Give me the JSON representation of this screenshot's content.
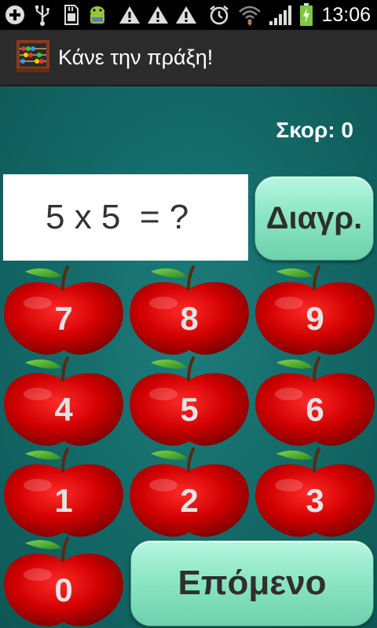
{
  "status_bar": {
    "time": "13:06",
    "icons": [
      "add-icon",
      "usb-icon",
      "sd-card-icon",
      "android-icon",
      "warning-icon",
      "warning-icon",
      "warning-icon",
      "alarm-icon",
      "wifi-icon",
      "signal-icon",
      "battery-charging-icon"
    ]
  },
  "title_bar": {
    "title": "Κάνε την πράξη!",
    "icon": "abacus-icon"
  },
  "game": {
    "score_label": "Σκορ: 0",
    "question": "5 x 5  = ?",
    "clear_label": "Διαγρ.",
    "next_label": "Επόμενο",
    "keypad": [
      "7",
      "8",
      "9",
      "4",
      "5",
      "6",
      "1",
      "2",
      "3",
      "0"
    ]
  },
  "colors": {
    "background": "#136866",
    "apple_red": "#d10000",
    "button_green": "#8de6c6",
    "title_bar": "#2b2b2b"
  }
}
